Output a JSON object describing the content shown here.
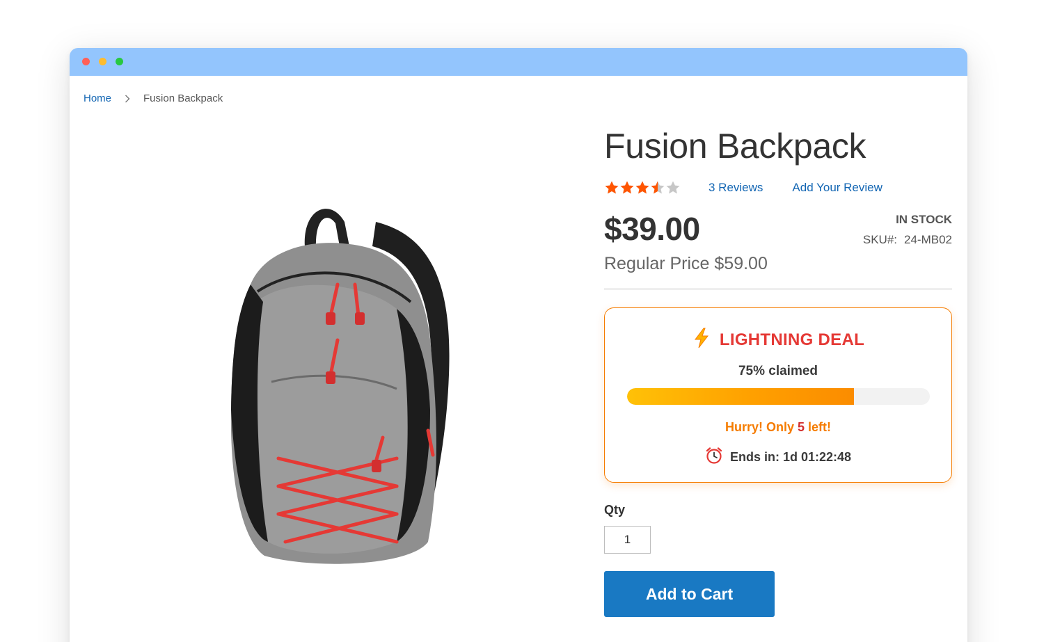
{
  "breadcrumb": {
    "home": "Home",
    "separator": "›",
    "current": "Fusion Backpack"
  },
  "product": {
    "title": "Fusion Backpack",
    "rating": {
      "value": 3.5,
      "max": 5,
      "filled_color": "#ff5501",
      "empty_color": "#c7c7c7"
    },
    "reviews_link": "3  Reviews",
    "add_review_link": "Add Your Review",
    "price": "$39.00",
    "regular_price": "Regular Price $59.00",
    "stock": "IN STOCK",
    "sku_label": "SKU#:",
    "sku_value": "24-MB02",
    "image_icon": "backpack-photo"
  },
  "deal": {
    "icon": "lightning-bolt-icon",
    "title": "LIGHTNING DEAL",
    "claimed_text": "75% claimed",
    "claimed_fraction": 0.75,
    "hurry_prefix": "Hurry! Only ",
    "hurry_count": "5",
    "hurry_suffix": " left!",
    "timer_icon": "alarm-clock-icon",
    "ends_text": "Ends in: 1d 01:22:48",
    "accent_color": "#f57c00",
    "title_color": "#e53935"
  },
  "purchase": {
    "qty_label": "Qty",
    "qty_value": "1",
    "add_to_cart_label": "Add to Cart",
    "button_color": "#1979c3"
  }
}
